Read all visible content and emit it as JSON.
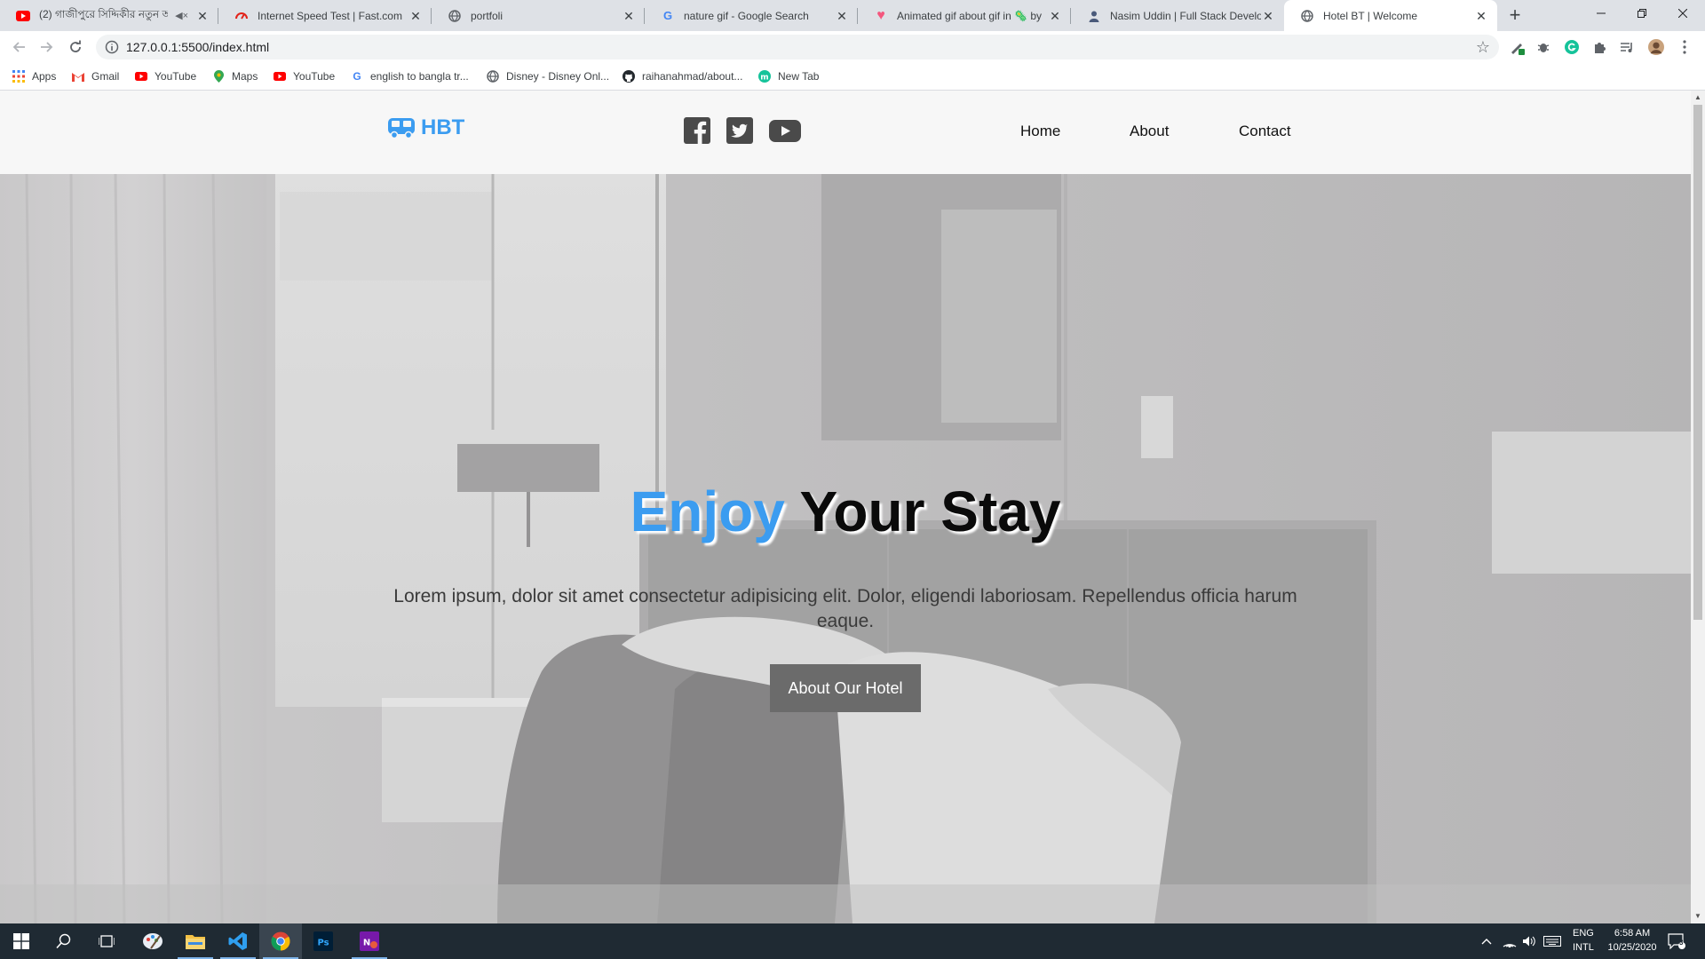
{
  "browser": {
    "tabs": [
      {
        "title": "(2) গাজীপুরে সিদ্দিকীর নতুন আ",
        "icon": "youtube-icon",
        "muted": true
      },
      {
        "title": "Internet Speed Test | Fast.com",
        "icon": "fast-icon"
      },
      {
        "title": "portfoli",
        "icon": "globe-icon"
      },
      {
        "title": "nature gif - Google Search",
        "icon": "google-icon"
      },
      {
        "title": "Animated gif about gif in 🦠 by",
        "icon": "heart-icon"
      },
      {
        "title": "Nasim Uddin | Full Stack Develop",
        "icon": "person-icon"
      },
      {
        "title": "Hotel BT | Welcome",
        "icon": "globe-icon",
        "active": true
      }
    ],
    "new_tab": "+",
    "url": "127.0.0.1:5500/index.html",
    "bookmarks": [
      {
        "label": "Apps",
        "icon": "apps-grid-icon"
      },
      {
        "label": "Gmail",
        "icon": "gmail-icon"
      },
      {
        "label": "YouTube",
        "icon": "youtube-icon"
      },
      {
        "label": "Maps",
        "icon": "maps-icon"
      },
      {
        "label": "YouTube",
        "icon": "youtube-icon"
      },
      {
        "label": "english to bangla tr...",
        "icon": "google-icon"
      },
      {
        "label": "Disney - Disney Onl...",
        "icon": "globe-icon"
      },
      {
        "label": "raihanahmad/about...",
        "icon": "github-icon"
      },
      {
        "label": "New Tab",
        "icon": "m-icon"
      }
    ]
  },
  "site": {
    "logo_text": "HBT",
    "socials": [
      "facebook-icon",
      "twitter-icon",
      "youtube-icon"
    ],
    "nav": [
      "Home",
      "About",
      "Contact"
    ],
    "hero": {
      "title_accent": "Enjoy",
      "title_rest": "Your Stay",
      "text": "Lorem ipsum, dolor sit amet consectetur adipisicing elit. Dolor, eligendi laboriosam. Repellendus officia harum eaque.",
      "button": "About Our Hotel"
    },
    "colors": {
      "accent": "#3b9cf0",
      "button": "#6b6b6b",
      "header_bg": "#f7f7f7"
    }
  },
  "taskbar": {
    "apps": [
      "windows-start-icon",
      "search-icon",
      "task-view-icon",
      "paint-icon",
      "file-explorer-icon",
      "vscode-icon",
      "chrome-icon",
      "photoshop-icon",
      "onenote-icon"
    ],
    "lang_top": "ENG",
    "lang_bottom": "INTL",
    "time": "6:58 AM",
    "date": "10/25/2020",
    "notifications": "3"
  }
}
